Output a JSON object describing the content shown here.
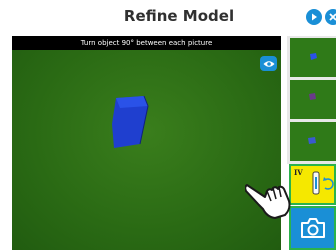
{
  "header": {
    "title": "Refine Model",
    "buttons": [
      {
        "name": "play-icon"
      },
      {
        "name": "close-icon"
      }
    ]
  },
  "camera": {
    "instruction": "Turn object 90° between each picture",
    "eye_button_icon": "eye-icon"
  },
  "sidebar": {
    "thumbnails": [
      {
        "name": "thumbnail-1"
      },
      {
        "name": "thumbnail-2"
      },
      {
        "name": "thumbnail-3"
      },
      {
        "name": "thumbnail-4-selected",
        "numeral": "IV"
      }
    ],
    "capture_button_icon": "camera-icon"
  },
  "colors": {
    "accent": "#1a8fd6",
    "selection": "#2bb24c",
    "slot_highlight": "#f5e800",
    "object": "#1f3fcf"
  }
}
